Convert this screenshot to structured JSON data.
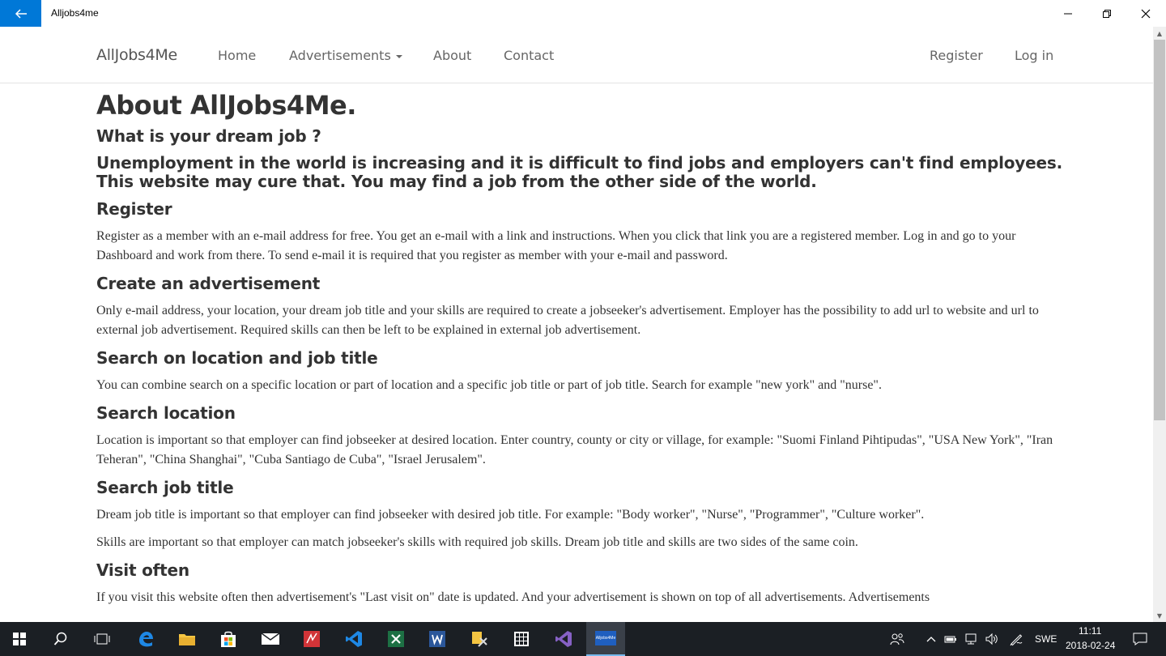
{
  "window": {
    "title": "Alljobs4me"
  },
  "navbar": {
    "brand": "AllJobs4Me",
    "links": [
      {
        "label": "Home"
      },
      {
        "label": "Advertisements"
      },
      {
        "label": "About"
      },
      {
        "label": "Contact"
      }
    ],
    "right_links": [
      {
        "label": "Register"
      },
      {
        "label": "Log in"
      }
    ]
  },
  "page": {
    "heading": "About AllJobs4Me.",
    "subheading": "What is your dream job ?",
    "lead": "Unemployment in the world is increasing and it is difficult to find jobs and employers can't find employees. This website may cure that. You may find a job from the other side of the world.",
    "sections": [
      {
        "title": "Register",
        "paragraphs": [
          "Register as a member with an e-mail address for free. You get an e-mail with a link and instructions. When you click that link you are a registered member. Log in and go to your Dashboard and work from there. To send e-mail it is required that you register as member with your e-mail and password."
        ]
      },
      {
        "title": "Create an advertisement",
        "paragraphs": [
          "Only e-mail address, your location, your dream job title and your skills are required to create a jobseeker's advertisement. Employer has the possibility to add url to website and url to external job advertisement. Required skills can then be left to be explained in external job advertisement."
        ]
      },
      {
        "title": "Search on location and job title",
        "paragraphs": [
          "You can combine search on a specific location or part of location and a specific job title or part of job title. Search for example \"new york\" and \"nurse\"."
        ]
      },
      {
        "title": "Search location",
        "paragraphs": [
          "Location is important so that employer can find jobseeker at desired location. Enter country, county or city or village, for example: \"Suomi Finland Pihtipudas\", \"USA New York\", \"Iran Teheran\", \"China Shanghai\", \"Cuba Santiago de Cuba\", \"Israel Jerusalem\"."
        ]
      },
      {
        "title": "Search job title",
        "paragraphs": [
          "Dream job title is important so that employer can find jobseeker with desired job title. For example: \"Body worker\", \"Nurse\", \"Programmer\", \"Culture worker\".",
          "Skills are important so that employer can match jobseeker's skills with required job skills. Dream job title and skills are two sides of the same coin."
        ]
      },
      {
        "title": "Visit often",
        "paragraphs": [
          "If you visit this website often then advertisement's \"Last visit on\" date is updated. And your advertisement is shown on top of all advertisements. Advertisements"
        ]
      }
    ]
  },
  "taskbar": {
    "active_app_label": "Alljobs4Me",
    "language": "SWE",
    "time": "11:11",
    "date": "2018-02-24"
  },
  "colors": {
    "accent": "#0078d7",
    "taskbar": "#1b1f24",
    "text": "#333333"
  }
}
